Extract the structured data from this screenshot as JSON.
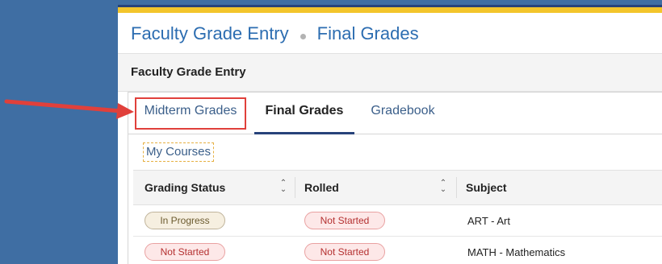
{
  "breadcrumb": {
    "items": [
      "Faculty Grade Entry",
      "Final Grades"
    ]
  },
  "section": {
    "title": "Faculty Grade Entry"
  },
  "tabs": [
    {
      "label": "Midterm Grades",
      "active": false
    },
    {
      "label": "Final Grades",
      "active": true
    },
    {
      "label": "Gradebook",
      "active": false
    }
  ],
  "subtab": {
    "label": "My Courses"
  },
  "table": {
    "columns": [
      "Grading Status",
      "Rolled",
      "Subject"
    ],
    "rows": [
      {
        "grading_status": "In Progress",
        "rolled": "Not Started",
        "subject": "ART - Art"
      },
      {
        "grading_status": "Not Started",
        "rolled": "Not Started",
        "subject": "MATH - Mathematics"
      }
    ]
  },
  "colors": {
    "background": "#3f6ea3",
    "accent_navy": "#27427a",
    "accent_gold": "#f3c52b",
    "annotation_red": "#e0403b",
    "link_blue": "#2c6db1"
  },
  "icons": {
    "sort": "sort-updown-icon",
    "annotation": "red-arrow-icon"
  }
}
